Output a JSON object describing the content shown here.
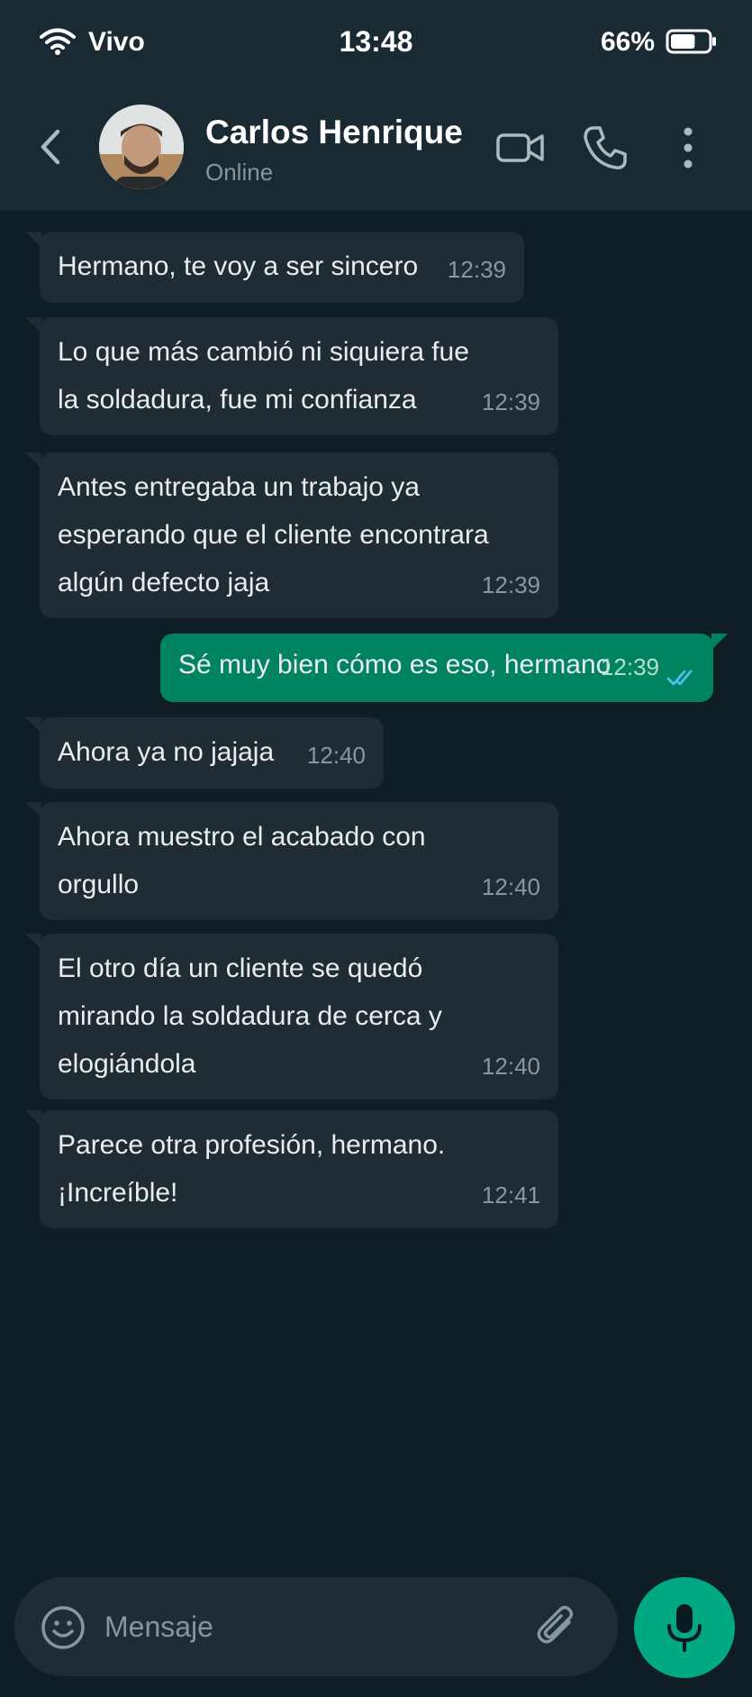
{
  "status_bar": {
    "carrier": "Vivo",
    "time": "13:48",
    "battery": "66%",
    "battery_level": 0.66
  },
  "header": {
    "contact_name": "Carlos Henrique",
    "contact_status": "Online",
    "icons": [
      "back-arrow-icon",
      "video-camera-icon",
      "phone-icon",
      "more-vertical-icon"
    ]
  },
  "messages": [
    {
      "dir": "in",
      "text": "Hermano, te voy a ser sincero",
      "time": "12:39"
    },
    {
      "dir": "in",
      "text": "Lo que más cambió ni siquiera fue\nla soldadura, fue mi confianza",
      "time": "12:39"
    },
    {
      "dir": "in",
      "text": "Antes entregaba un trabajo ya\nesperando que el cliente encontrara\nalgún defecto jaja",
      "time": "12:39"
    },
    {
      "dir": "out",
      "text": "Sé muy bien cómo es eso, hermano",
      "time": "12:39",
      "status": "read"
    },
    {
      "dir": "in",
      "text": "Ahora ya no jajaja",
      "time": "12:40"
    },
    {
      "dir": "in",
      "text": "Ahora muestro el acabado con\norgullo",
      "time": "12:40"
    },
    {
      "dir": "in",
      "text": "El otro día un cliente se quedó\nmirando la soldadura de cerca y\nelogiándola",
      "time": "12:40"
    },
    {
      "dir": "in",
      "text": "Parece otra profesión, hermano.\n¡Increíble!",
      "time": "12:41"
    }
  ],
  "composer": {
    "placeholder": "Mensaje",
    "icons": [
      "emoji-icon",
      "attach-icon",
      "microphone-icon"
    ]
  },
  "colors": {
    "background": "#0f1d24",
    "header": "#1a2a33",
    "incoming_bubble": "#202c33",
    "outgoing_bubble": "#00835f",
    "accent": "#00a884",
    "read_ticks": "#53bdeb"
  }
}
